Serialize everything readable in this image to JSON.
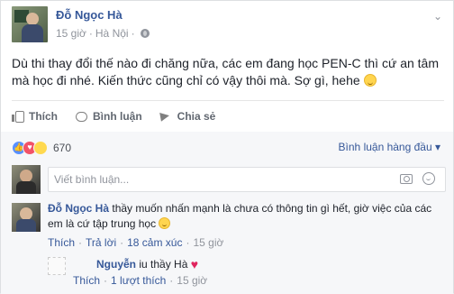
{
  "post": {
    "author": "Đỗ Ngọc Hà",
    "time": "15 giờ",
    "location": "Hà Nội",
    "text": "Dù thi thay đổi thế nào đi chăng nữa, các em đang học PEN-C thì cứ an tâm mà học đi nhé. Kiến thức cũng chỉ có vậy thôi mà. Sợ gì, hehe"
  },
  "actions": {
    "like_label": "Thích",
    "comment_label": "Bình luận",
    "share_label": "Chia sẻ"
  },
  "reactions": {
    "count": "670",
    "sort_label": "Bình luận hàng đầu ▾"
  },
  "comment_input": {
    "placeholder": "Viết bình luận..."
  },
  "comments": [
    {
      "author": "Đỗ Ngọc Hà",
      "text": "thầy muốn nhấn mạnh là chưa có thông tin gì hết, giờ việc của các em là cứ tập trung học",
      "like_label": "Thích",
      "reply_label": "Trả lời",
      "reactions_label": "18 cảm xúc",
      "time": "15 giờ"
    }
  ],
  "reply": {
    "author_prefix": "",
    "author": "Nguyễn",
    "text": "iu thầy Hà",
    "like_label": "Thích",
    "reactions_label": "1 lượt thích",
    "time": "15 giờ"
  },
  "icons": {
    "heart": "♥",
    "dot_sep": "·",
    "globe": "globe-icon",
    "chevron": "⌄"
  },
  "colors": {
    "link": "#365899",
    "muted": "#90949c",
    "like": "#5890ff",
    "love": "#f25268",
    "haha": "#ffd94f"
  }
}
